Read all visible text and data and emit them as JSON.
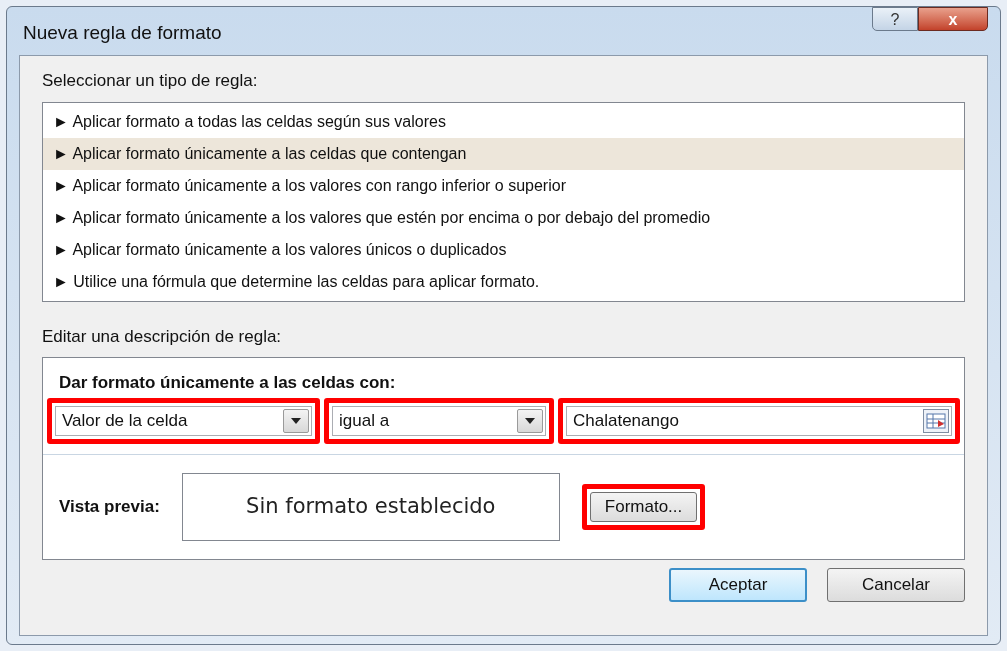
{
  "window": {
    "title": "Nueva regla de formato",
    "help_button": "?",
    "close_button": "x"
  },
  "rule_type": {
    "label": "Seleccionar un tipo de regla:",
    "items": [
      {
        "marker": "►",
        "text": "Aplicar formato a todas las celdas según sus valores",
        "selected": false
      },
      {
        "marker": "►",
        "text": "Aplicar formato únicamente a las celdas que contengan",
        "selected": true
      },
      {
        "marker": "►",
        "text": "Aplicar formato únicamente a los valores con rango inferior o superior",
        "selected": false
      },
      {
        "marker": "►",
        "text": "Aplicar formato únicamente a los valores que estén por encima o por debajo del promedio",
        "selected": false
      },
      {
        "marker": "►",
        "text": "Aplicar formato únicamente a los valores únicos o duplicados",
        "selected": false
      },
      {
        "marker": "►",
        "text": "Utilice una fórmula que determine las celdas para aplicar formato.",
        "selected": false
      }
    ]
  },
  "rule_description": {
    "label": "Editar una descripción de regla:",
    "heading": "Dar formato únicamente a las celdas con:",
    "conditions": [
      {
        "kind": "dropdown",
        "value": "Valor de la celda",
        "highlighted": true
      },
      {
        "kind": "dropdown",
        "value": "igual a",
        "highlighted": true
      },
      {
        "kind": "reference",
        "value": "Chalatenango",
        "highlighted": true
      }
    ],
    "preview_label": "Vista previa:",
    "preview_text": "Sin formato establecido",
    "format_button": {
      "label": "Formato...",
      "highlighted": true
    }
  },
  "buttons": [
    {
      "label": "Aceptar",
      "default": true
    },
    {
      "label": "Cancelar",
      "default": false
    }
  ]
}
